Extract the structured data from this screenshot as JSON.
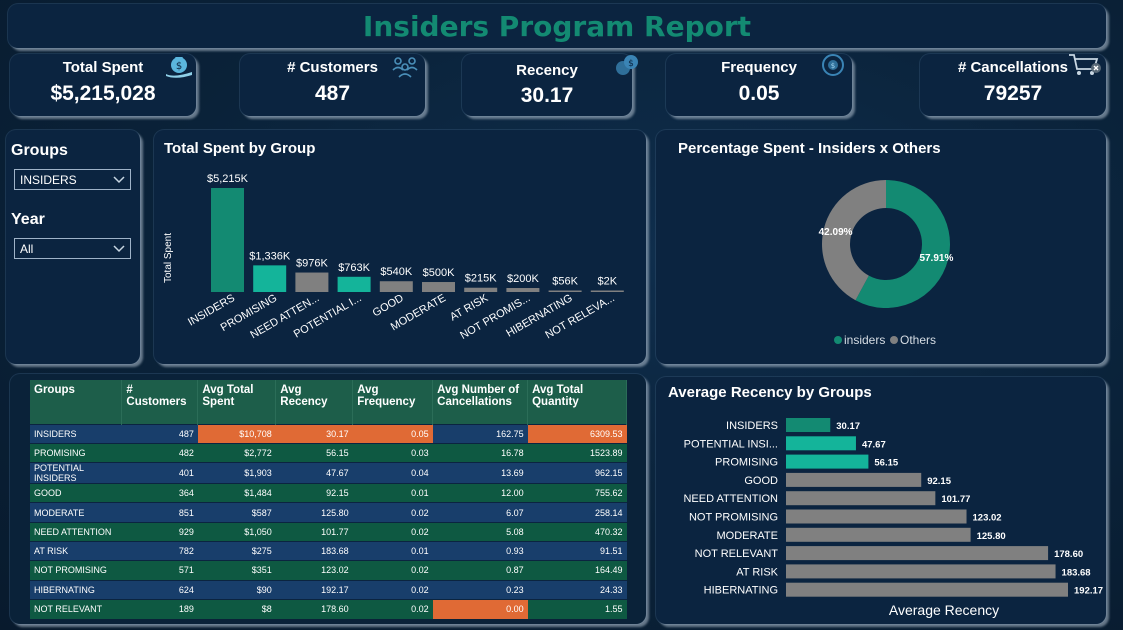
{
  "page": {
    "title": "Insiders Program Report"
  },
  "kpis": [
    {
      "label": "Total Spent",
      "value": "$5,215,028",
      "icon": "money-bag-icon"
    },
    {
      "label": "# Customers",
      "value": "487",
      "icon": "people-group-icon"
    },
    {
      "label": "Recency",
      "value": "30.17",
      "icon": "coins-icon"
    },
    {
      "label": "Frequency",
      "value": "0.05",
      "icon": "clock-coins-icon"
    },
    {
      "label": "# Cancellations",
      "value": "79257",
      "icon": "cart-cancel-icon"
    }
  ],
  "filters": {
    "groups_label": "Groups",
    "groups_value": "INSIDERS",
    "year_label": "Year",
    "year_value": "All"
  },
  "bar_panel": {
    "title": "Total Spent by Group",
    "ylabel": "Total Spent"
  },
  "donut_panel": {
    "title": "Percentage Spent - Insiders x Others"
  },
  "table": {
    "headers": [
      "Groups",
      "# Customers",
      "Avg Total Spent",
      "Avg Recency",
      "Avg Frequency",
      "Avg Number of Cancellations",
      "Avg Total Quantity"
    ],
    "rows": [
      [
        "INSIDERS",
        "487",
        "$10,708",
        "30.17",
        "0.05",
        "162.75",
        "6309.53"
      ],
      [
        "PROMISING",
        "482",
        "$2,772",
        "56.15",
        "0.03",
        "16.78",
        "1523.89"
      ],
      [
        "POTENTIAL INSIDERS",
        "401",
        "$1,903",
        "47.67",
        "0.04",
        "13.69",
        "962.15"
      ],
      [
        "GOOD",
        "364",
        "$1,484",
        "92.15",
        "0.01",
        "12.00",
        "755.62"
      ],
      [
        "MODERATE",
        "851",
        "$587",
        "125.80",
        "0.02",
        "6.07",
        "258.14"
      ],
      [
        "NEED ATTENTION",
        "929",
        "$1,050",
        "101.77",
        "0.02",
        "5.08",
        "470.32"
      ],
      [
        "AT RISK",
        "782",
        "$275",
        "183.68",
        "0.01",
        "0.93",
        "91.51"
      ],
      [
        "NOT PROMISING",
        "571",
        "$351",
        "123.02",
        "0.02",
        "0.87",
        "164.49"
      ],
      [
        "HIBERNATING",
        "624",
        "$90",
        "192.17",
        "0.02",
        "0.23",
        "24.33"
      ],
      [
        "NOT RELEVANT",
        "189",
        "$8",
        "178.60",
        "0.02",
        "0.00",
        "1.55"
      ]
    ]
  },
  "recency_panel": {
    "title": "Average Recency by Groups"
  },
  "colors": {
    "teal": "#138a72",
    "teal_light": "#14b49a",
    "gray": "#808080",
    "orange": "#e06a35"
  },
  "chart_data": [
    {
      "type": "bar",
      "title": "Total Spent by Group",
      "ylabel": "Total Spent",
      "categories": [
        "INSIDERS",
        "PROMISING",
        "NEED ATTEN...",
        "POTENTIAL I...",
        "GOOD",
        "MODERATE",
        "AT RISK",
        "NOT PROMIS...",
        "HIBERNATING",
        "NOT RELEVA..."
      ],
      "values": [
        5215,
        1336,
        976,
        763,
        540,
        500,
        215,
        200,
        56,
        2
      ],
      "labels": [
        "$5,215K",
        "$1,336K",
        "$976K",
        "$763K",
        "$540K",
        "$500K",
        "$215K",
        "$200K",
        "$56K",
        "$2K"
      ],
      "bar_colors": [
        "#138a72",
        "#14b49a",
        "#808080",
        "#14b49a",
        "#808080",
        "#808080",
        "#808080",
        "#808080",
        "#808080",
        "#808080"
      ],
      "ylim": [
        0,
        5215
      ]
    },
    {
      "type": "pie",
      "title": "Percentage Spent - Insiders x Others",
      "labels": [
        "insiders",
        "Others"
      ],
      "values": [
        57.91,
        42.09
      ],
      "value_labels": [
        "57.91%",
        "42.09%"
      ],
      "colors": [
        "#138a72",
        "#808080"
      ],
      "legend": "bottom"
    },
    {
      "type": "bar",
      "orientation": "horizontal",
      "title": "Average Recency by Groups",
      "xlabel": "Average Recency",
      "categories": [
        "INSIDERS",
        "POTENTIAL INSI...",
        "PROMISING",
        "GOOD",
        "NEED ATTENTION",
        "NOT PROMISING",
        "MODERATE",
        "NOT RELEVANT",
        "AT RISK",
        "HIBERNATING"
      ],
      "values": [
        30.17,
        47.67,
        56.15,
        92.15,
        101.77,
        123.02,
        125.8,
        178.6,
        183.68,
        192.17
      ],
      "labels": [
        "30.17",
        "47.67",
        "56.15",
        "92.15",
        "101.77",
        "123.02",
        "125.80",
        "178.60",
        "183.68",
        "192.17"
      ],
      "bar_colors": [
        "#138a72",
        "#14b49a",
        "#14b49a",
        "#808080",
        "#808080",
        "#808080",
        "#808080",
        "#808080",
        "#808080",
        "#808080"
      ]
    }
  ]
}
